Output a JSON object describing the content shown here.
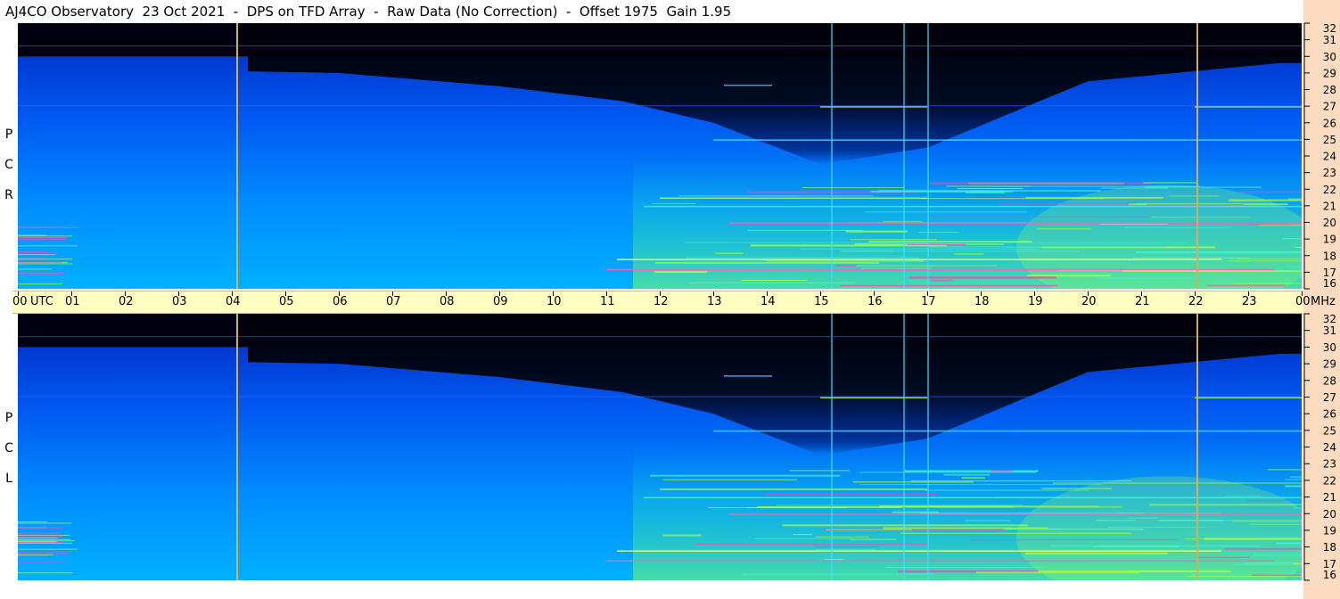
{
  "header": {
    "title": "AJ4CO Observatory  23 Oct 2021  -  DPS on TFD Array  -  Raw Data (No Correction)  -  Offset 1975  Gain 1.95"
  },
  "panels": [
    {
      "id": "rcp",
      "polarization_label": [
        "R",
        "C",
        "P"
      ]
    },
    {
      "id": "lcp",
      "polarization_label": [
        "L",
        "C",
        "P"
      ]
    }
  ],
  "time_axis": {
    "labels": [
      "00",
      "UTC",
      "01",
      "02",
      "03",
      "04",
      "05",
      "06",
      "07",
      "08",
      "09",
      "10",
      "11",
      "12",
      "13",
      "14",
      "15",
      "16",
      "17",
      "18",
      "19",
      "20",
      "21",
      "22",
      "23",
      "00",
      "MHz"
    ]
  },
  "chart_data": {
    "type": "heatmap",
    "title": "AJ4CO Observatory  23 Oct 2021  -  DPS on TFD Array  -  Raw Data (No Correction)  -  Offset 1975  Gain 1.95",
    "x": {
      "label": "UTC",
      "range_hours": [
        0,
        24
      ],
      "tick_labels": [
        "00",
        "01",
        "02",
        "03",
        "04",
        "05",
        "06",
        "07",
        "08",
        "09",
        "10",
        "11",
        "12",
        "13",
        "14",
        "15",
        "16",
        "17",
        "18",
        "19",
        "20",
        "21",
        "22",
        "23",
        "00"
      ]
    },
    "y": {
      "label": "MHz",
      "range": [
        16,
        32
      ],
      "tick_labels": [
        "16",
        "17",
        "18",
        "19",
        "20",
        "21",
        "22",
        "23",
        "24",
        "25",
        "26",
        "27",
        "28",
        "29",
        "30",
        "31",
        "32"
      ]
    },
    "series": [
      {
        "name": "RCP"
      },
      {
        "name": "LCP"
      }
    ],
    "colors": {
      "low": "#000010",
      "mid": "#0050ff",
      "high": "#00b0ff",
      "hot": "#a0ff40",
      "max": "#ff40c0",
      "marker": "#d0b060"
    },
    "marker_lines_hours": [
      4.1,
      22.05
    ]
  }
}
